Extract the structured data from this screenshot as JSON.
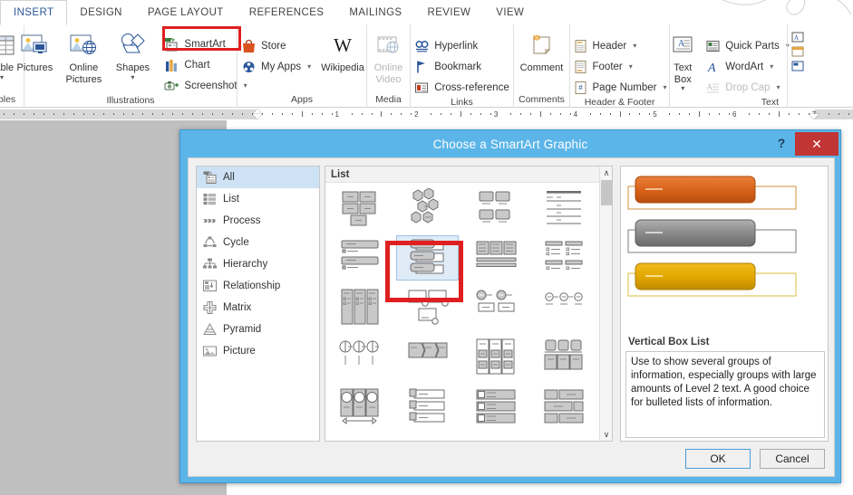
{
  "ribbon": {
    "tabs": [
      {
        "label": "INSERT",
        "active": true
      },
      {
        "label": "DESIGN",
        "active": false
      },
      {
        "label": "PAGE LAYOUT",
        "active": false
      },
      {
        "label": "REFERENCES",
        "active": false
      },
      {
        "label": "MAILINGS",
        "active": false
      },
      {
        "label": "REVIEW",
        "active": false
      },
      {
        "label": "VIEW",
        "active": false
      }
    ],
    "groups": [
      {
        "label": "Tables",
        "big": [
          {
            "label": "Table",
            "icon": "table-icon",
            "dropdown": true,
            "disabled": false
          }
        ],
        "small": []
      },
      {
        "label": "Illustrations",
        "big": [
          {
            "label": "Pictures",
            "icon": "pictures-icon",
            "dropdown": false,
            "disabled": false
          },
          {
            "label": "Online Pictures",
            "icon": "online-pictures-icon",
            "dropdown": false,
            "disabled": false
          },
          {
            "label": "Shapes",
            "icon": "shapes-icon",
            "dropdown": true,
            "disabled": false
          }
        ],
        "small": [
          {
            "label": "SmartArt",
            "icon": "smartart-icon",
            "dropdown": false,
            "disabled": false
          },
          {
            "label": "Chart",
            "icon": "chart-icon",
            "dropdown": false,
            "disabled": false
          },
          {
            "label": "Screenshot",
            "icon": "screenshot-icon",
            "dropdown": true,
            "disabled": false
          }
        ]
      },
      {
        "label": "Apps",
        "big": [
          {
            "label": "Wikipedia",
            "icon": "wikipedia-icon",
            "dropdown": false,
            "disabled": false
          }
        ],
        "small": [
          {
            "label": "Store",
            "icon": "store-icon",
            "dropdown": false,
            "disabled": false
          },
          {
            "label": "My Apps",
            "icon": "my-apps-icon",
            "dropdown": true,
            "disabled": false
          }
        ]
      },
      {
        "label": "Media",
        "big": [
          {
            "label": "Online Video",
            "icon": "online-video-icon",
            "dropdown": false,
            "disabled": true
          }
        ],
        "small": []
      },
      {
        "label": "Links",
        "big": [],
        "small": [
          {
            "label": "Hyperlink",
            "icon": "hyperlink-icon",
            "dropdown": false,
            "disabled": false
          },
          {
            "label": "Bookmark",
            "icon": "bookmark-icon",
            "dropdown": false,
            "disabled": false
          },
          {
            "label": "Cross-reference",
            "icon": "cross-reference-icon",
            "dropdown": false,
            "disabled": false
          }
        ]
      },
      {
        "label": "Comments",
        "big": [
          {
            "label": "Comment",
            "icon": "comment-icon",
            "dropdown": false,
            "disabled": false
          }
        ],
        "small": []
      },
      {
        "label": "Header & Footer",
        "big": [],
        "small": [
          {
            "label": "Header",
            "icon": "header-icon",
            "dropdown": true,
            "disabled": false
          },
          {
            "label": "Footer",
            "icon": "footer-icon",
            "dropdown": true,
            "disabled": false
          },
          {
            "label": "Page Number",
            "icon": "page-number-icon",
            "dropdown": true,
            "disabled": false
          }
        ]
      },
      {
        "label": "Text",
        "big": [
          {
            "label": "Text Box",
            "icon": "text-box-icon",
            "dropdown": true,
            "disabled": false
          }
        ],
        "small": [
          {
            "label": "Quick Parts",
            "icon": "quick-parts-icon",
            "dropdown": true,
            "disabled": false
          },
          {
            "label": "WordArt",
            "icon": "wordart-icon",
            "dropdown": true,
            "disabled": false
          },
          {
            "label": "Drop Cap",
            "icon": "drop-cap-icon",
            "dropdown": true,
            "disabled": true
          }
        ]
      }
    ],
    "highlight_color": "#e02020"
  },
  "ruler": {
    "numbers": [
      "1",
      "2",
      "3",
      "4",
      "5",
      "6",
      "7"
    ]
  },
  "dialog": {
    "title": "Choose a SmartArt Graphic",
    "help_label": "?",
    "close_label": "✕",
    "accent_color": "#5bb5e8",
    "close_color": "#c13535",
    "categories": [
      {
        "label": "All",
        "icon": "all-icon",
        "selected": true
      },
      {
        "label": "List",
        "icon": "list-icon",
        "selected": false
      },
      {
        "label": "Process",
        "icon": "process-icon",
        "selected": false
      },
      {
        "label": "Cycle",
        "icon": "cycle-icon",
        "selected": false
      },
      {
        "label": "Hierarchy",
        "icon": "hierarchy-icon",
        "selected": false
      },
      {
        "label": "Relationship",
        "icon": "relationship-icon",
        "selected": false
      },
      {
        "label": "Matrix",
        "icon": "matrix-icon",
        "selected": false
      },
      {
        "label": "Pyramid",
        "icon": "pyramid-icon",
        "selected": false
      },
      {
        "label": "Picture",
        "icon": "picture-icon",
        "selected": false
      }
    ],
    "gallery": {
      "header": "List",
      "selected_index": 5,
      "scroll_up_label": "∧",
      "scroll_down_label": "∨",
      "thumbnails": [
        {
          "name": "basic-block-list",
          "type": "blocks"
        },
        {
          "name": "alternating-hexagons",
          "type": "hexagons"
        },
        {
          "name": "picture-caption-list",
          "type": "picture-caption"
        },
        {
          "name": "lined-list",
          "type": "lines"
        },
        {
          "name": "vertical-bullet-list",
          "type": "bars-bullets"
        },
        {
          "name": "vertical-box-list",
          "type": "vertical-box"
        },
        {
          "name": "vertical-bracket-list",
          "type": "three-panels"
        },
        {
          "name": "vertical-chevron-list",
          "type": "bars-indent"
        },
        {
          "name": "vertical-block-list",
          "type": "tall-columns"
        },
        {
          "name": "horizontal-picture-list",
          "type": "circle-boxes"
        },
        {
          "name": "stacked-list",
          "type": "circle-pair"
        },
        {
          "name": "detailed-process",
          "type": "circle-dash"
        },
        {
          "name": "pie-process",
          "type": "pie-dash"
        },
        {
          "name": "grouped-list",
          "type": "arrow-panels"
        },
        {
          "name": "tab-list",
          "type": "grid-columns"
        },
        {
          "name": "square-accent-list",
          "type": "squares-top"
        },
        {
          "name": "horizontal-bullet-list",
          "type": "circle-arrow"
        },
        {
          "name": "alternating-picture-blocks",
          "type": "offset-bars"
        },
        {
          "name": "table-list",
          "type": "checkbox-bars"
        },
        {
          "name": "trapezoid-list",
          "type": "mixed-blocks"
        }
      ]
    },
    "preview": {
      "name": "Vertical Box List",
      "description": "Use to show several groups of information, especially groups with large amounts of Level 2 text. A good choice for bulleted lists of information.",
      "shape_colors": [
        "#d9631a",
        "#8a8a8a",
        "#e3a800"
      ]
    },
    "buttons": [
      {
        "label": "OK",
        "default": true
      },
      {
        "label": "Cancel",
        "default": false
      }
    ]
  }
}
